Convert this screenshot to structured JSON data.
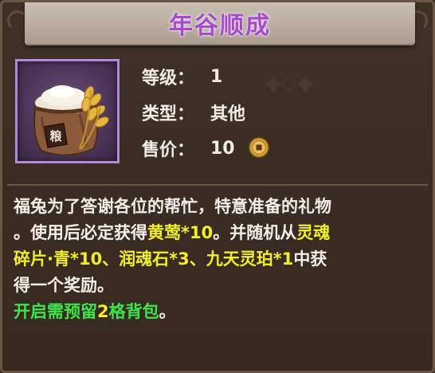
{
  "title": "年谷顺成",
  "item": {
    "icon": "grain-sack-icon",
    "icon_char": "粮"
  },
  "stats": [
    {
      "label": "等级：",
      "value": "1"
    },
    {
      "label": "类型：",
      "value": "其他"
    },
    {
      "label": "售价：",
      "value": "10",
      "icon": "copper-coin-icon"
    }
  ],
  "description": {
    "line1": "福兔为了答谢各位的帮忙，特意准备的礼物",
    "line2_a": "。使用后必定获得",
    "line2_b": "黄莺*10",
    "line2_c": "。并随机从",
    "line2_d": "灵魂",
    "line3_a": "碎片·青*10、润魂石*3、九天灵珀*1",
    "line3_b": "中获",
    "line4": "得一个奖励。",
    "line5_a": "开启需预留",
    "line5_b": "2",
    "line5_c": "格背包",
    "line5_d": "。"
  },
  "colors": {
    "title": "#a64bc9",
    "highlight_yellow": "#f2ee2a",
    "highlight_green": "#3ee64a",
    "frame_purple": "#b488d6"
  }
}
